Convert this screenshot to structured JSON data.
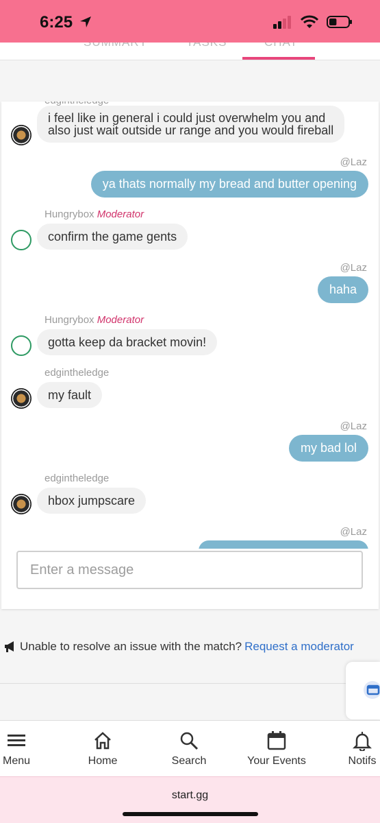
{
  "status_bar": {
    "time": "6:25",
    "battery_level": 0.4
  },
  "tabs": [
    {
      "label": "SUMMARY",
      "active": false
    },
    {
      "label": "TASKS",
      "active": false
    },
    {
      "label": "CHAT",
      "active": true
    }
  ],
  "chat": {
    "partial_top_sender": "edgintheledge",
    "messages": [
      {
        "sender": "edgintheledge",
        "text_line1": "i feel like in general i could just overwhelm you and",
        "text_line2": "also just wait outside ur range and you would fireball"
      },
      {
        "handle": "@Laz",
        "text": "ya thats normally my bread and butter opening"
      },
      {
        "sender": "Hungrybox",
        "role": "Moderator",
        "text": "confirm the game gents"
      },
      {
        "handle": "@Laz",
        "text": "haha"
      },
      {
        "sender": "Hungrybox",
        "role": "Moderator",
        "text": "gotta keep da bracket movin!"
      },
      {
        "sender": "edgintheledge",
        "text": "my fault"
      },
      {
        "handle": "@Laz",
        "text": "my bad lol"
      },
      {
        "sender": "edgintheledge",
        "text": "hbox jumpscare"
      },
      {
        "handle": "@Laz",
        "text": ""
      }
    ],
    "input_placeholder": "Enter a message"
  },
  "issue": {
    "text": "Unable to resolve an issue with the match?",
    "link": "Request a moderator"
  },
  "nav": [
    {
      "label": "Menu",
      "icon": "menu-icon"
    },
    {
      "label": "Home",
      "icon": "home-icon"
    },
    {
      "label": "Search",
      "icon": "search-icon"
    },
    {
      "label": "Your Events",
      "icon": "calendar-icon"
    },
    {
      "label": "Notifs",
      "icon": "bell-icon"
    }
  ],
  "browser": {
    "url": "start.gg"
  },
  "colors": {
    "status_bar": "#f7708f",
    "accent": "#e8467c",
    "outgoing_bubble": "#7db6cf",
    "moderator": "#d1336b",
    "link": "#2f6fc9"
  }
}
